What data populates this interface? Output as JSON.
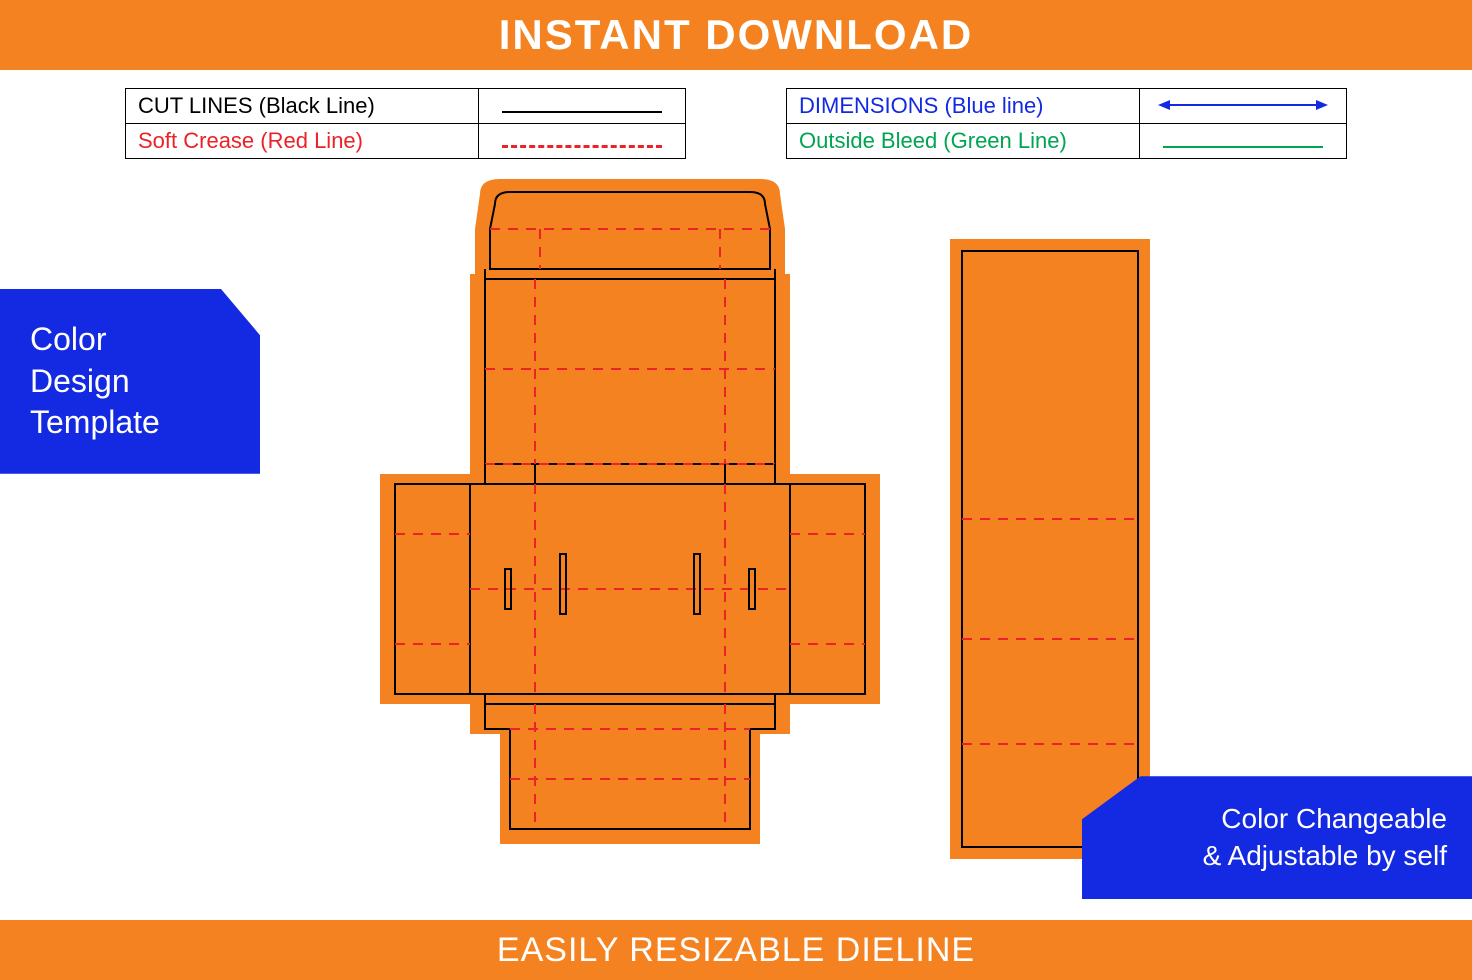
{
  "header": {
    "title": "INSTANT DOWNLOAD"
  },
  "legend": {
    "cut": "CUT LINES (Black Line)",
    "crease": "Soft Crease (Red Line)",
    "dimensions": "DIMENSIONS (Blue line)",
    "bleed": "Outside Bleed (Green Line)"
  },
  "badges": {
    "left": "Color\nDesign\nTemplate",
    "right": "Color Changeable\n& Adjustable by self"
  },
  "footer": {
    "title": "EASILY RESIZABLE DIELINE"
  },
  "colors": {
    "orange": "#F58220",
    "blue": "#1329E2",
    "red": "#EB2227",
    "green": "#00A551",
    "black": "#000000"
  }
}
